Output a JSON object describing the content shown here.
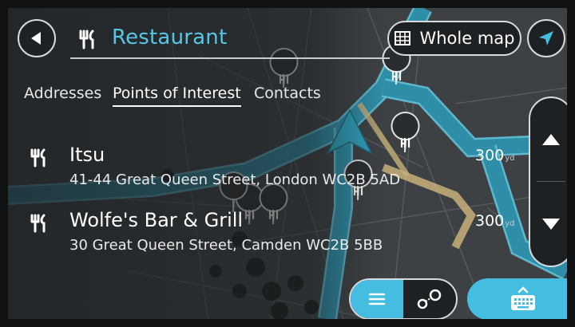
{
  "search": {
    "query": "Restaurant"
  },
  "header": {
    "whole_map_label": "Whole map"
  },
  "tabs": [
    {
      "label": "Addresses",
      "active": false
    },
    {
      "label": "Points of Interest",
      "active": true
    },
    {
      "label": "Contacts",
      "active": false
    }
  ],
  "results": [
    {
      "name": "Itsu",
      "address": "41-44 Great Queen Street, London WC2B 5AD",
      "distance": "300",
      "unit": "yd"
    },
    {
      "name": "Wolfe's Bar & Grill",
      "address": "30 Great Queen Street, Camden WC2B 5BB",
      "distance": "300",
      "unit": "yd"
    }
  ],
  "icons": {
    "back": "back-arrow-icon",
    "category": "restaurant-fork-knife-icon",
    "whole_map": "map-grid-icon",
    "navigate": "navigation-arrow-icon",
    "scroll_up": "chevron-up-icon",
    "scroll_down": "chevron-down-icon",
    "list_view": "list-icon",
    "map_view": "route-pins-icon",
    "keyboard": "keyboard-icon"
  },
  "colors": {
    "accent": "#45bde0",
    "search_text": "#56c8e6",
    "route": "#2f8ea9",
    "panel": "#1e2123"
  }
}
